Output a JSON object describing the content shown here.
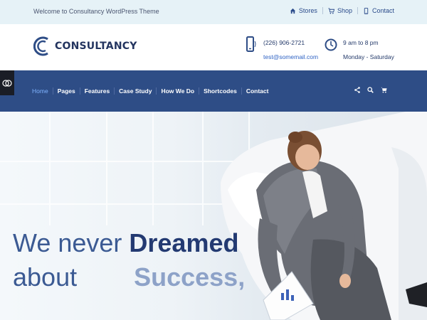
{
  "topbar": {
    "welcome": "Welcome to Consultancy WordPress Theme",
    "links": [
      {
        "label": "Stores",
        "icon": "home-icon"
      },
      {
        "label": "Shop",
        "icon": "cart-icon"
      },
      {
        "label": "Contact",
        "icon": "phone-icon"
      }
    ]
  },
  "header": {
    "logo_text": "CONSULTANCY",
    "phone": "(226) 906-2721",
    "email": "test@somemail.com",
    "hours": "9 am to 8 pm",
    "days": "Monday - Saturday"
  },
  "nav": {
    "items": [
      "Home",
      "Pages",
      "Features",
      "Case Study",
      "How We Do",
      "Shortcodes",
      "Contact"
    ],
    "icons": [
      "share-icon",
      "search-icon",
      "cart-icon"
    ]
  },
  "hero": {
    "line1_thin": "We never ",
    "line1_bold": "Dreamed",
    "line2_thin": "about",
    "line2_bold": "Success,"
  },
  "colors": {
    "brand": "#2e4d86",
    "topbar_bg": "#e6f2f7",
    "nav_active": "#7fb3ff"
  }
}
